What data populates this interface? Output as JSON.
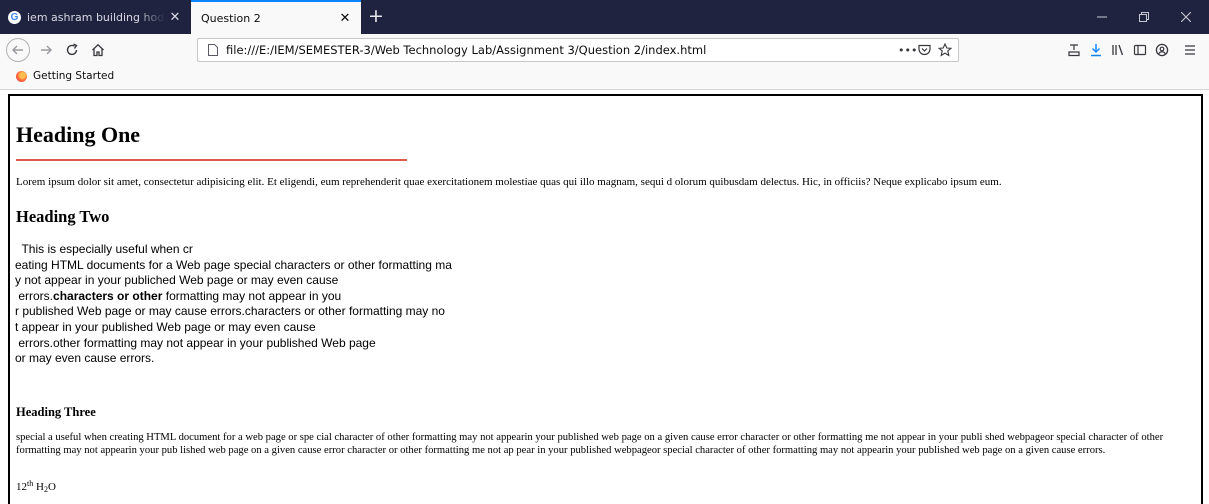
{
  "browser": {
    "tabs": [
      {
        "title": "iem ashram building hod - Goo",
        "close": "✕"
      },
      {
        "title": "Question 2",
        "close": "✕"
      }
    ],
    "new_tab": "+",
    "url": "file:///E:/IEM/SEMESTER-3/Web Technology Lab/Assignment 3/Question 2/index.html",
    "page_actions": "•••",
    "bookmark": "Getting Started",
    "accent_color": "#0a84ff",
    "tabstrip_color": "#202340"
  },
  "page": {
    "heading_one": "Heading One",
    "paragraph_one": "Lorem ipsum dolor sit amet, consectetur adipisicing elit. Et eligendi, eum reprehenderit quae exercitationem molestiae quas qui illo magnam, sequi d olorum quibusdam delectus. Hic, in officiis? Neque explicabo ipsum eum.",
    "heading_two": "Heading Two",
    "pre_lines": [
      "  This is especially useful when cr",
      "eating HTML documents for a Web page special characters or other formatting ma",
      "y not appear in your publiched Web page or may even cause",
      " errors."
    ],
    "pre_bold": "characters or other",
    "pre_after_bold": " formatting may not appear in you",
    "pre_lines_2": [
      "r published Web page or may cause errors.characters or other formatting may no",
      "t appear in your published Web page or may even cause",
      " errors.other formatting may not appear in your published Web page",
      "or may even cause errors."
    ],
    "heading_three": "Heading Three",
    "paragraph_three": "special a useful when creating HTML document for a web page or spe cial character of other formatting may not appearin your published web page on a given cause error character or other formatting me not appear in your publi shed webpageor special character of other formatting may not appearin your pub lished web page on a given cause error character or other formatting me not ap pear in your published webpageor special character of other formatting may not appearin your published web page on a given cause errors.",
    "number": "12",
    "superscript": "th",
    "chem_h": "H",
    "subscript": "2",
    "chem_o": "O",
    "rule_color": "#e05a4e"
  }
}
